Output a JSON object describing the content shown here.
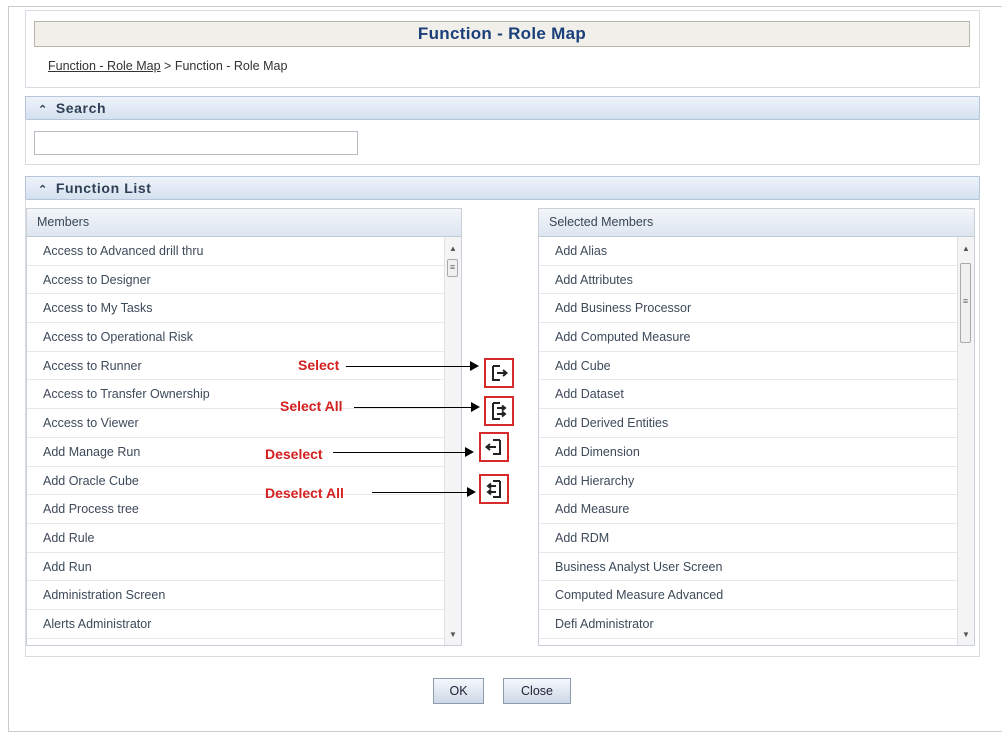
{
  "header": {
    "title": "Function - Role Map",
    "breadcrumb_link": "Function - Role Map",
    "breadcrumb_separator": ">",
    "breadcrumb_current": "Function - Role Map"
  },
  "search": {
    "label": "Search",
    "value": ""
  },
  "function_list": {
    "label": "Function List",
    "members_header": "Members",
    "selected_header": "Selected Members",
    "members": [
      "Access to Advanced drill thru",
      "Access to Designer",
      "Access to My Tasks",
      "Access to Operational Risk",
      "Access to Runner",
      "Access to Transfer Ownership",
      "Access to Viewer",
      "Add Manage Run",
      "Add Oracle Cube",
      "Add Process tree",
      "Add Rule",
      "Add Run",
      "Administration Screen",
      "Alerts Administrator"
    ],
    "selected_members": [
      "Add Alias",
      "Add Attributes",
      "Add Business Processor",
      "Add Computed Measure",
      "Add Cube",
      "Add Dataset",
      "Add Derived Entities",
      "Add Dimension",
      "Add Hierarchy",
      "Add Measure",
      "Add RDM",
      "Business Analyst User Screen",
      "Computed Measure Advanced",
      "Defi Administrator"
    ]
  },
  "annotations": {
    "select": "Select",
    "select_all": "Select All",
    "deselect": "Deselect",
    "deselect_all": "Deselect All"
  },
  "buttons": {
    "ok": "OK",
    "close": "Close"
  },
  "colors": {
    "title_text": "#1b3f7a",
    "annotation_red": "#d52020"
  }
}
